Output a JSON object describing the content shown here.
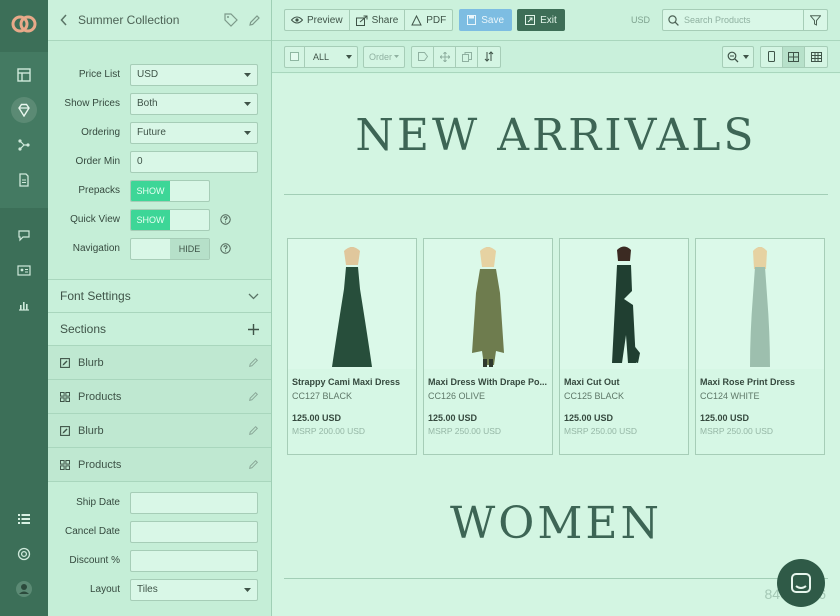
{
  "panel": {
    "title": "Summer Collection"
  },
  "form": {
    "price_list": {
      "label": "Price List",
      "value": "USD"
    },
    "show_prices": {
      "label": "Show Prices",
      "value": "Both"
    },
    "ordering": {
      "label": "Ordering",
      "value": "Future"
    },
    "order_min": {
      "label": "Order Min",
      "value": "0"
    },
    "prepacks": {
      "label": "Prepacks",
      "on": "SHOW"
    },
    "quick_view": {
      "label": "Quick View",
      "on": "SHOW"
    },
    "navigation": {
      "label": "Navigation",
      "off": "HIDE"
    }
  },
  "sections": {
    "font_settings": "Font Settings",
    "title": "Sections",
    "items": [
      "Blurb",
      "Products",
      "Blurb",
      "Products"
    ]
  },
  "form2": {
    "ship_date": {
      "label": "Ship Date",
      "value": ""
    },
    "cancel_date": {
      "label": "Cancel Date",
      "value": ""
    },
    "discount": {
      "label": "Discount %",
      "value": ""
    },
    "layout": {
      "label": "Layout",
      "value": "Tiles"
    }
  },
  "toolbar": {
    "preview": "Preview",
    "share": "Share",
    "pdf": "PDF",
    "save": "Save",
    "exit": "Exit",
    "currency": "USD",
    "search_placeholder": "Search Products"
  },
  "toolbar2": {
    "filter": "ALL",
    "order": "Order"
  },
  "canvas": {
    "heading1": "NEW ARRIVALS",
    "heading2": "WOMEN",
    "products": [
      {
        "name": "Strappy Cami Maxi Dress",
        "sku": "CC127 BLACK",
        "price": "125.00 USD",
        "msrp": "MSRP 200.00 USD",
        "color": "#274e3b"
      },
      {
        "name": "Maxi Dress With Drape Po...",
        "sku": "CC126 OLIVE",
        "price": "125.00 USD",
        "msrp": "MSRP 250.00 USD",
        "color": "#6e7c4e"
      },
      {
        "name": "Maxi Cut Out",
        "sku": "CC125 BLACK",
        "price": "125.00 USD",
        "msrp": "MSRP 250.00 USD",
        "color": "#203f31"
      },
      {
        "name": "Maxi Rose Print Dress",
        "sku": "CC124 WHITE",
        "price": "125.00 USD",
        "msrp": "MSRP 250.00 USD",
        "color": "#9dbfae"
      }
    ],
    "watermark": "840 x 616"
  },
  "colors": {
    "accent": "#3dd697",
    "save": "#7dbde2",
    "exit": "#3e6e57",
    "rail": "#3c6f58"
  }
}
